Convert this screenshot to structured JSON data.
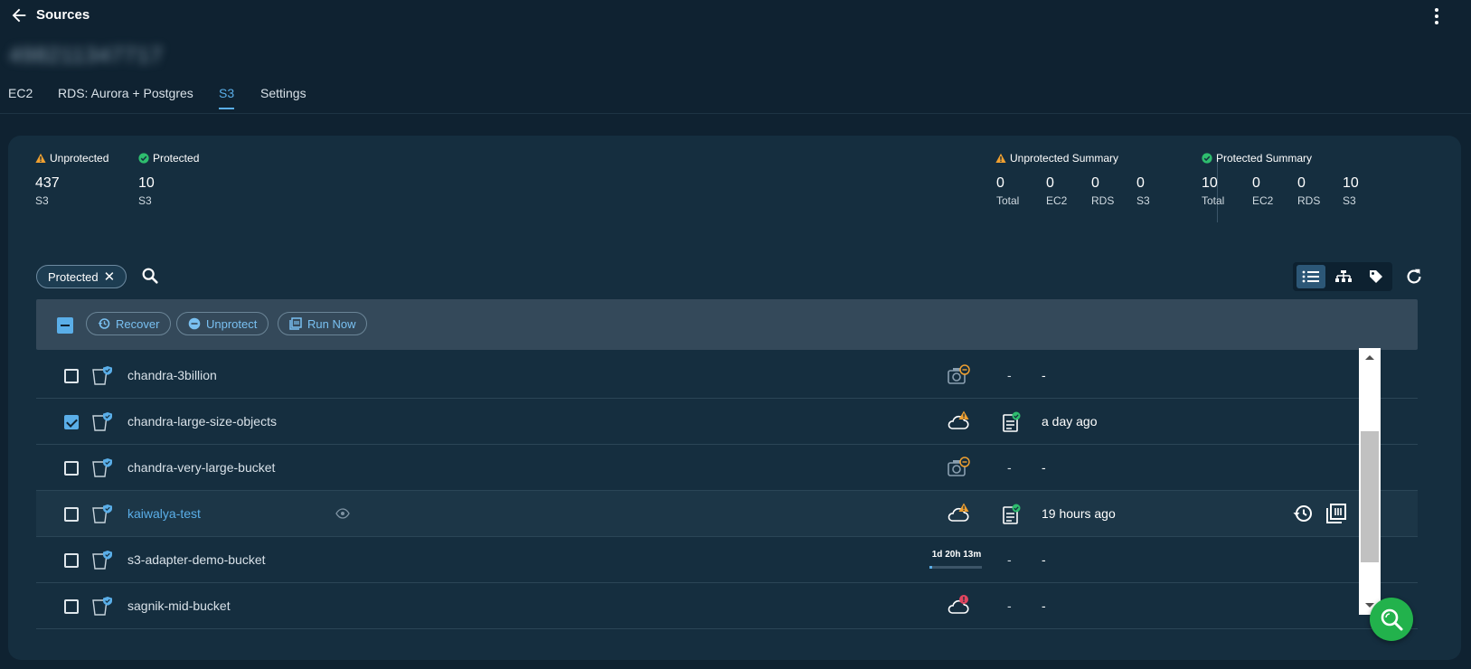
{
  "header": {
    "title": "Sources",
    "account_id": "498211347717"
  },
  "tabs": [
    {
      "label": "EC2",
      "active": false
    },
    {
      "label": "RDS: Aurora + Postgres",
      "active": false
    },
    {
      "label": "S3",
      "active": true
    },
    {
      "label": "Settings",
      "active": false
    }
  ],
  "stats": {
    "unprotected": {
      "label": "Unprotected",
      "value": "437",
      "unit": "S3"
    },
    "protected": {
      "label": "Protected",
      "value": "10",
      "unit": "S3"
    },
    "unprotected_summary": {
      "label": "Unprotected Summary",
      "items": [
        {
          "value": "0",
          "label": "Total"
        },
        {
          "value": "0",
          "label": "EC2"
        },
        {
          "value": "0",
          "label": "RDS"
        },
        {
          "value": "0",
          "label": "S3"
        }
      ]
    },
    "protected_summary": {
      "label": "Protected Summary",
      "items": [
        {
          "value": "10",
          "label": "Total"
        },
        {
          "value": "0",
          "label": "EC2"
        },
        {
          "value": "0",
          "label": "RDS"
        },
        {
          "value": "10",
          "label": "S3"
        }
      ]
    }
  },
  "filter": {
    "chip_label": "Protected",
    "chip_close": "✕"
  },
  "toolbar": {
    "recover": "Recover",
    "unprotect": "Unprotect",
    "run_now": "Run Now"
  },
  "rows": [
    {
      "name": "chandra-3billion",
      "checked": false,
      "status_icon": "camera-minus-icon",
      "policy": "-",
      "last_run": "-"
    },
    {
      "name": "chandra-large-size-objects",
      "checked": true,
      "status_icon": "cloud-warning-icon",
      "policy": "policy-check-icon",
      "last_run": "a day ago"
    },
    {
      "name": "chandra-very-large-bucket",
      "checked": false,
      "status_icon": "camera-minus-icon",
      "policy": "-",
      "last_run": "-"
    },
    {
      "name": "kaiwalya-test",
      "checked": false,
      "status_icon": "cloud-warning-icon",
      "policy": "policy-check-icon",
      "last_run": "19 hours ago"
    },
    {
      "name": "s3-adapter-demo-bucket",
      "checked": false,
      "timer": "1d 20h 13m",
      "timer_progress": 0.06,
      "policy": "-",
      "last_run": "-"
    },
    {
      "name": "sagnik-mid-bucket",
      "checked": false,
      "status_icon": "cloud-error-icon",
      "policy": "-",
      "last_run": "-"
    }
  ],
  "colors": {
    "accent": "#5aaee8",
    "warning": "#f0a030",
    "success": "#2ebd6e",
    "error": "#e0455f",
    "fab": "#22b24c"
  }
}
